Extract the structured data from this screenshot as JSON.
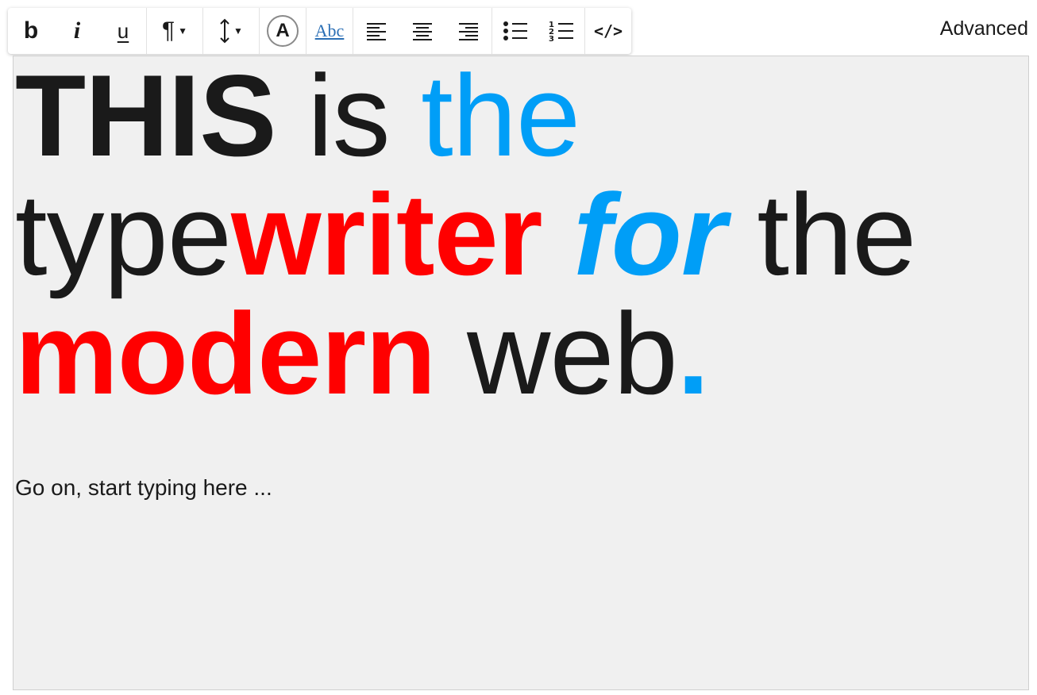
{
  "toolbar": {
    "bold_label": "b",
    "italic_label": "i",
    "underline_label": "u",
    "paragraph_label": "¶",
    "font_label": "A",
    "spellcheck_label": "Abc",
    "code_label": "</>"
  },
  "advanced_link": "Advanced",
  "headline": {
    "line1": [
      {
        "text": "THIS",
        "color": "#1a1a1a",
        "bold": true
      },
      {
        "text": " is ",
        "color": "#1a1a1a",
        "bold": false
      },
      {
        "text": "the",
        "color": "#009ef7",
        "bold": false
      }
    ],
    "line2": [
      {
        "text": "type",
        "color": "#1a1a1a",
        "bold": false
      },
      {
        "text": "writer",
        "color": "#ff0000",
        "bold": true
      },
      {
        "text": " ",
        "color": "#1a1a1a",
        "bold": false
      },
      {
        "text": "for",
        "color": "#009ef7",
        "bold": true,
        "italic": true
      },
      {
        "text": " the",
        "color": "#1a1a1a",
        "bold": false
      }
    ],
    "line3": [
      {
        "text": "modern",
        "color": "#ff0000",
        "bold": true
      },
      {
        "text": " web",
        "color": "#1a1a1a",
        "bold": false
      },
      {
        "text": ".",
        "color": "#009ef7",
        "bold": true
      }
    ]
  },
  "placeholder": "Go on, start typing here ...",
  "colors": {
    "accent_blue": "#009ef7",
    "accent_red": "#ff0000",
    "text_dark": "#1a1a1a",
    "editor_bg": "#f0f0f0"
  },
  "icons": [
    "bold-icon",
    "italic-icon",
    "underline-icon",
    "paragraph-icon",
    "line-height-icon",
    "font-color-icon",
    "spellcheck-icon",
    "align-left-icon",
    "align-center-icon",
    "align-right-icon",
    "bullet-list-icon",
    "numbered-list-icon",
    "code-icon"
  ]
}
